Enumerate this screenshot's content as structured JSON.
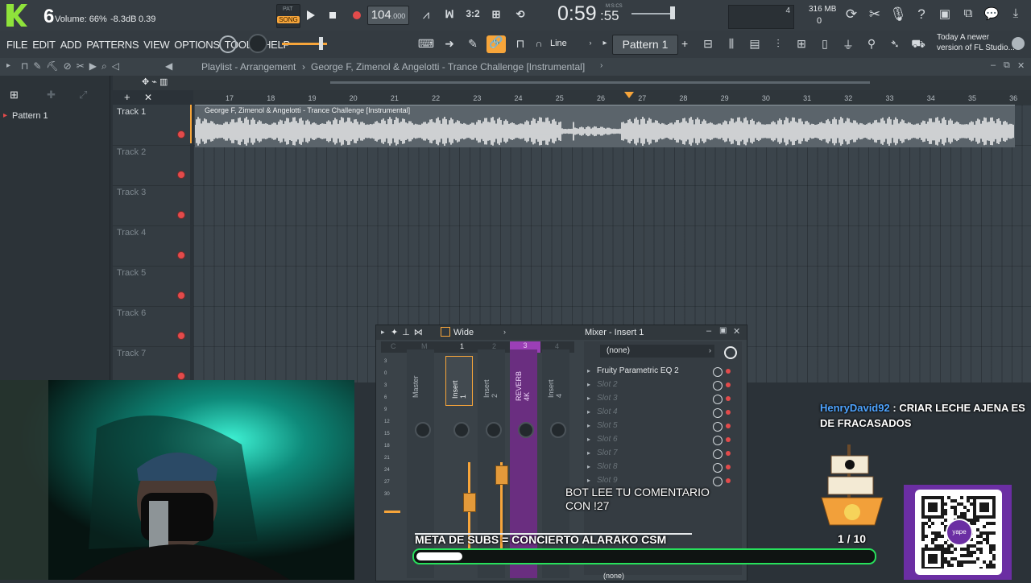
{
  "topbar": {
    "logo_number": "6",
    "volume": "Volume: 66%",
    "db": "-8.3dB",
    "value": "0.39",
    "pat_label": "PAT",
    "song_label": "SONG",
    "tempo": "104",
    "tempo_decimals": ".000",
    "time_main": "0:59",
    "time_small": ":55",
    "time_unit": "M:S:CS",
    "cpu_value": "4",
    "memory": "316 MB",
    "poly": "0",
    "news_line1": "Today  A newer",
    "news_line2": "version of FL Studio..."
  },
  "menu": {
    "items": [
      "FILE",
      "EDIT",
      "ADD",
      "PATTERNS",
      "VIEW",
      "OPTIONS",
      "TOOLS",
      "HELP"
    ],
    "snap_label": "Line",
    "pattern_label": "Pattern 1",
    "pattern_add": "+"
  },
  "playlist": {
    "header_title": "Playlist - Arrangement",
    "header_separator": "›",
    "header_song": "George F, Zimenol & Angelotti - Trance Challenge [Instrumental]",
    "ruler_numbers": [
      "17",
      "18",
      "19",
      "20",
      "21",
      "22",
      "23",
      "24",
      "25",
      "26",
      "27",
      "28",
      "29",
      "30",
      "31",
      "32",
      "33",
      "34",
      "35",
      "36"
    ],
    "pattern_item": "Pattern 1",
    "tracks": [
      "Track 1",
      "Track 2",
      "Track 3",
      "Track 4",
      "Track 5",
      "Track 6",
      "Track 7"
    ],
    "clip_label": "George F, Zimenol & Angelotti - Trance Challenge [Instrumental]"
  },
  "mixer": {
    "title": "Mixer - Insert 1",
    "mode": "Wide",
    "channel_numbers": [
      "C",
      "M",
      "1",
      "2",
      "3",
      "4"
    ],
    "strips": [
      "Master",
      "Insert 1",
      "Insert 2",
      "REVERB 4K",
      "Insert 4"
    ],
    "input_select": "(none)",
    "output_select": "(none)",
    "slots": [
      "Fruity Parametric EQ 2",
      "Slot 2",
      "Slot 3",
      "Slot 4",
      "Slot 5",
      "Slot 6",
      "Slot 7",
      "Slot 8",
      "Slot 9"
    ],
    "meter_ticks": [
      "3",
      "0",
      "3",
      "6",
      "9",
      "12",
      "15",
      "18",
      "21",
      "24",
      "27",
      "30"
    ]
  },
  "overlay": {
    "chat_user": "HenryDavid92",
    "chat_sep": ":",
    "chat_message_1": "CRIAR LECHE AJENA ES",
    "chat_message_2": "DE FRACASADOS",
    "bot_line1": "BOT LEE TU COMENTARIO",
    "bot_line2": "CON !27",
    "goal_label": "META DE SUBS = CONCIERTO ALARAKO CSM",
    "goal_count": "1  / 10",
    "goal_progress": 0.1,
    "qr_brand": "yape"
  },
  "colors": {
    "accent_orange": "#f7a53a",
    "progress_green": "#27e05b",
    "record_red": "#e34b4b",
    "qr_purple": "#6b2ea3",
    "reverb_purple": "#9b3fb6"
  }
}
